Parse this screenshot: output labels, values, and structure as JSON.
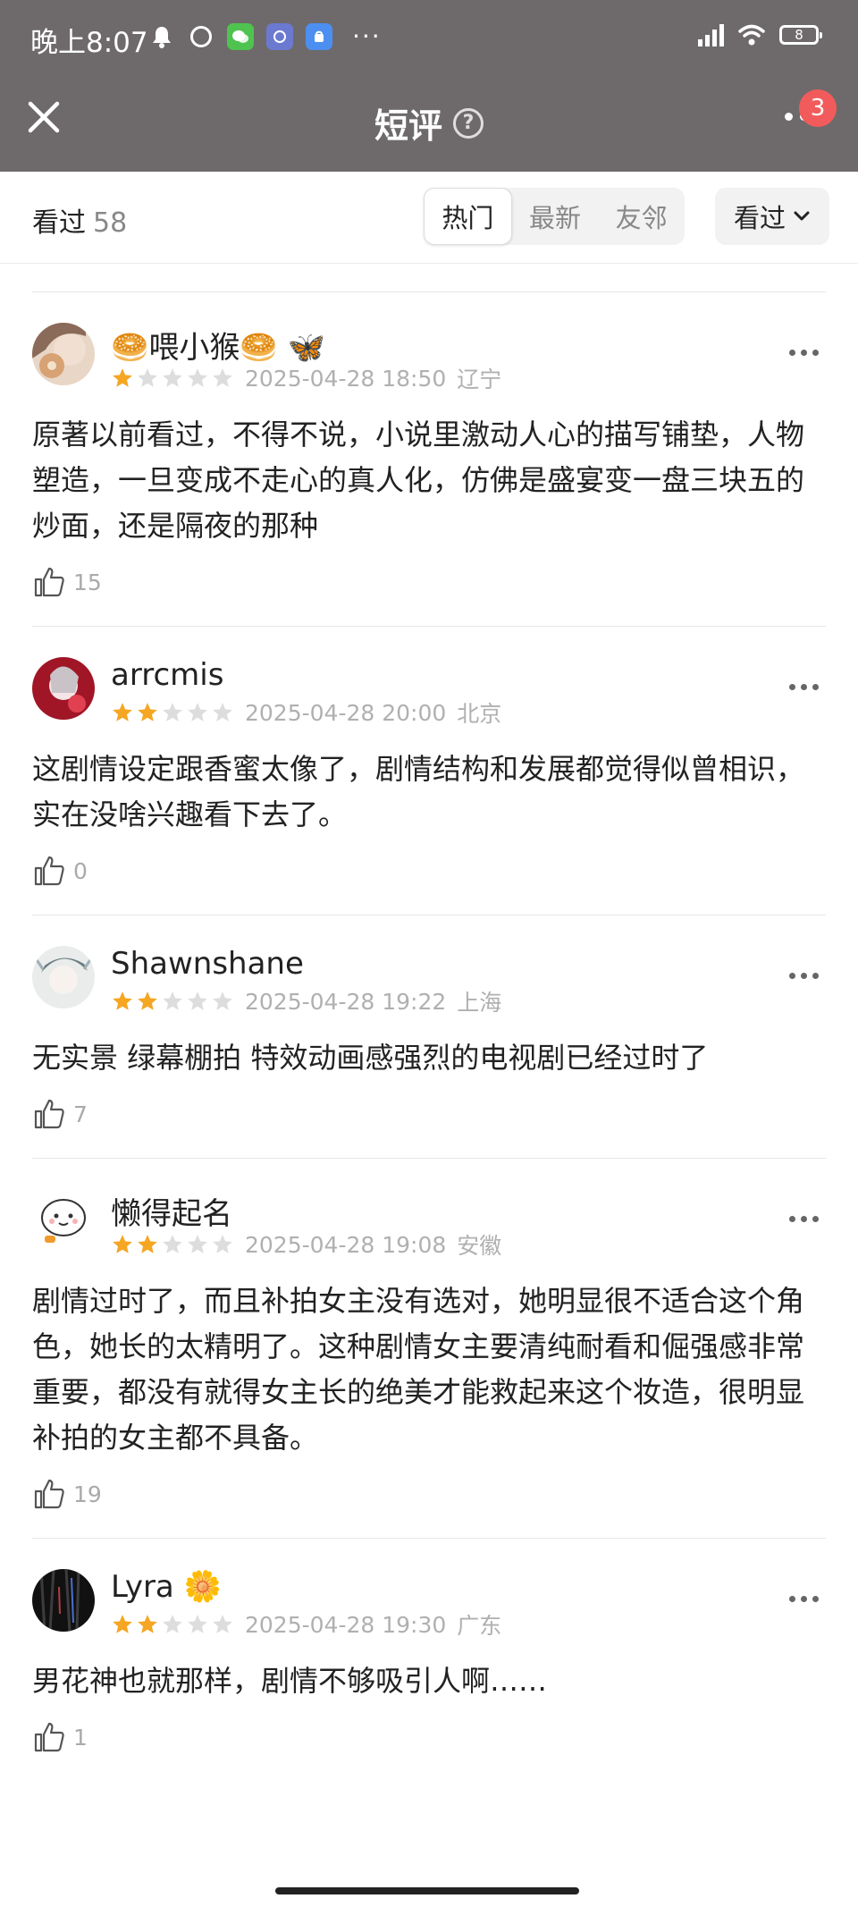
{
  "status_bar": {
    "time": "晚上8:07",
    "battery": "8",
    "icons": [
      "bell-icon",
      "alarm-icon",
      "wechat-icon",
      "app-icon",
      "app-icon",
      "more-icon",
      "signal-icon",
      "wifi-icon",
      "battery-icon"
    ]
  },
  "nav": {
    "title": "短评",
    "badge_count": "3",
    "help_glyph": "?"
  },
  "filter": {
    "seen_label": "看过",
    "seen_count": "58",
    "tabs": [
      {
        "label": "热门",
        "active": true
      },
      {
        "label": "最新",
        "active": false
      },
      {
        "label": "友邻",
        "active": false
      }
    ],
    "status_select": "看过"
  },
  "colors": {
    "header_bg": "#6e6a6b",
    "star_on": "#f5a623",
    "star_off": "#dddddd",
    "badge": "#f25b5b"
  },
  "reviews": [
    {
      "user": "🥯喂小猴🥯 🦋",
      "rating": 1,
      "date": "2025-04-28 18:50",
      "location": "辽宁",
      "text": "原著以前看过，不得不说，小说里激动人心的描写铺垫，人物塑造，一旦变成不走心的真人化，仿佛是盛宴变一盘三块五的炒面，还是隔夜的那种",
      "likes": "15"
    },
    {
      "user": "arrcmis",
      "rating": 2,
      "date": "2025-04-28 20:00",
      "location": "北京",
      "text": "这剧情设定跟香蜜太像了，剧情结构和发展都觉得似曾相识，实在没啥兴趣看下去了。",
      "likes": "0"
    },
    {
      "user": "Shawnshane",
      "rating": 2,
      "date": "2025-04-28 19:22",
      "location": "上海",
      "text": "无实景 绿幕棚拍 特效动画感强烈的电视剧已经过时了",
      "likes": "7"
    },
    {
      "user": "懒得起名",
      "rating": 2,
      "date": "2025-04-28 19:08",
      "location": "安徽",
      "text": "剧情过时了，而且补拍女主没有选对，她明显很不适合这个角色，她长的太精明了。这种剧情女主要清纯耐看和倔强感非常重要，都没有就得女主长的绝美才能救起来这个妆造，很明显补拍的女主都不具备。",
      "likes": "19"
    },
    {
      "user": "Lyra 🌼",
      "rating": 2,
      "date": "2025-04-28 19:30",
      "location": "广东",
      "text": "男花神也就那样，剧情不够吸引人啊……",
      "likes": "1"
    }
  ]
}
